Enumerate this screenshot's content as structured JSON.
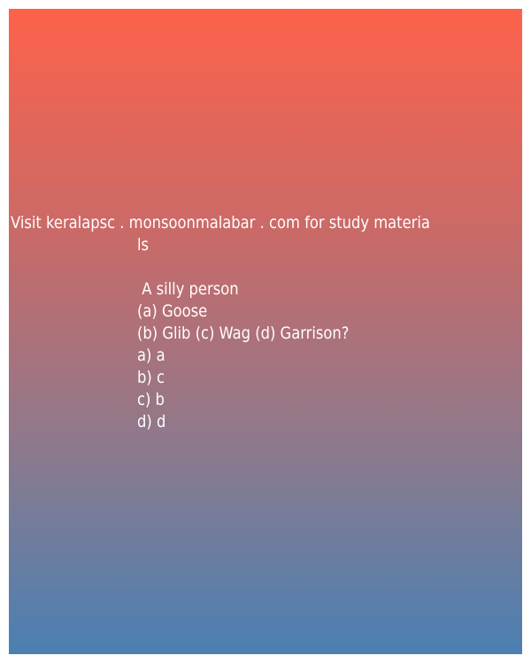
{
  "header_line1": "Visit keralapsc . monsoonmalabar . com for study materia",
  "header_line2": "ls",
  "question": " A silly person",
  "question_lines": [
    "(a) Goose",
    "(b) Glib (c) Wag (d) Garrison?"
  ],
  "options": [
    "a) a",
    "b) c",
    "c) b",
    "d) d"
  ]
}
